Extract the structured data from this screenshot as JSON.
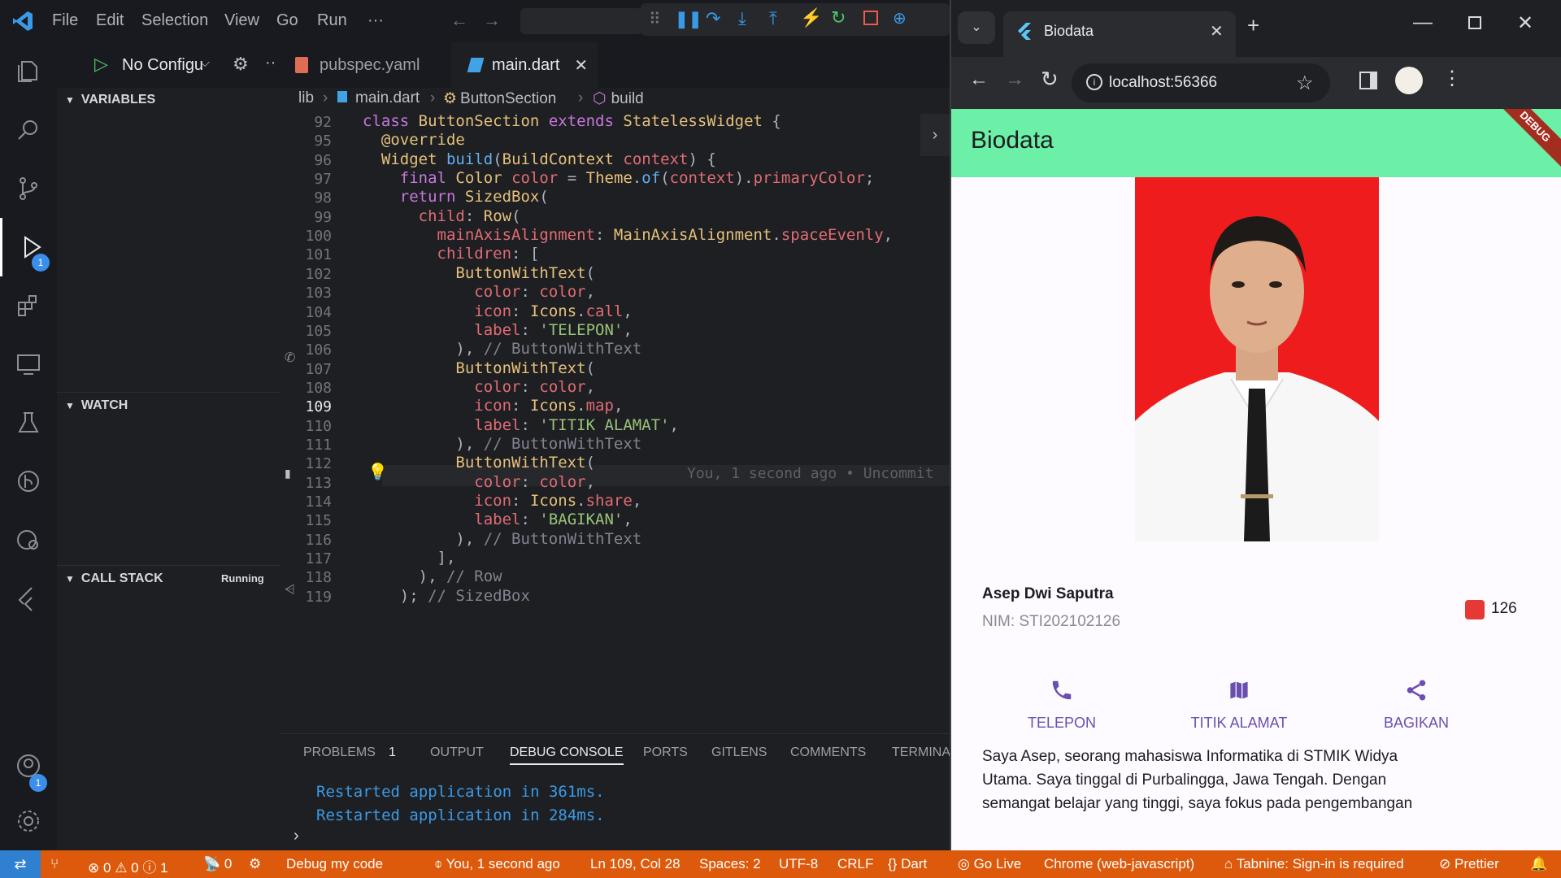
{
  "vscode": {
    "menu": [
      "File",
      "Edit",
      "Selection",
      "View",
      "Go",
      "Run",
      "···"
    ],
    "run_config": "No Configu",
    "tabs": [
      {
        "label": "pubspec.yaml"
      },
      {
        "label": "main.dart"
      }
    ],
    "breadcrumb": [
      "lib",
      "main.dart",
      "ButtonSection",
      "build"
    ],
    "sidebar": {
      "variables": "VARIABLES",
      "watch": "WATCH",
      "call_stack": "CALL STACK",
      "call_stack_status": "Running"
    },
    "activity_badges": {
      "debug": "1",
      "accounts": "1"
    },
    "code_lines": [
      {
        "n": "92",
        "t": "class ButtonSection extends StatelessWidget {"
      },
      {
        "n": "95",
        "t": "  @override"
      },
      {
        "n": "96",
        "t": "  Widget build(BuildContext context) {"
      },
      {
        "n": "97",
        "t": "    final Color color = Theme.of(context).primaryColor;"
      },
      {
        "n": "98",
        "t": "    return SizedBox("
      },
      {
        "n": "99",
        "t": "      child: Row("
      },
      {
        "n": "100",
        "t": "        mainAxisAlignment: MainAxisAlignment.spaceEvenly,"
      },
      {
        "n": "101",
        "t": "        children: ["
      },
      {
        "n": "102",
        "t": "          ButtonWithText("
      },
      {
        "n": "103",
        "t": "            color: color,"
      },
      {
        "n": "104",
        "t": "            icon: Icons.call,"
      },
      {
        "n": "105",
        "t": "            label: 'TELEPON',"
      },
      {
        "n": "106",
        "t": "          ), // ButtonWithText"
      },
      {
        "n": "107",
        "t": "          ButtonWithText("
      },
      {
        "n": "108",
        "t": "            color: color,"
      },
      {
        "n": "109",
        "t": "            icon: Icons.map,"
      },
      {
        "n": "110",
        "t": "            label: 'TITIK ALAMAT',"
      },
      {
        "n": "111",
        "t": "          ), // ButtonWithText"
      },
      {
        "n": "112",
        "t": "          ButtonWithText("
      },
      {
        "n": "113",
        "t": "            color: color,"
      },
      {
        "n": "114",
        "t": "            icon: Icons.share,"
      },
      {
        "n": "115",
        "t": "            label: 'BAGIKAN',"
      },
      {
        "n": "116",
        "t": "          ), // ButtonWithText"
      },
      {
        "n": "117",
        "t": "        ],"
      },
      {
        "n": "118",
        "t": "      ), // Row"
      },
      {
        "n": "119",
        "t": "    ); // SizedBox"
      }
    ],
    "blame": "You, 1 second ago • Uncommit",
    "panel_tabs": [
      "PROBLEMS",
      "1",
      "OUTPUT",
      "DEBUG CONSOLE",
      "PORTS",
      "GITLENS",
      "COMMENTS",
      "TERMINA"
    ],
    "console": [
      "Restarted application in 361ms.",
      "Restarted application in 284ms."
    ],
    "status": {
      "errors": "0",
      "warnings": "0",
      "info": "1",
      "ports": "0",
      "debug": "Debug my code",
      "blame": "You, 1 second ago",
      "position": "Ln 109, Col 28",
      "spaces": "Spaces: 2",
      "encoding": "UTF-8",
      "eol": "CRLF",
      "lang": "Dart",
      "golive": "Go Live",
      "device": "Chrome (web-javascript)",
      "tabnine": "Tabnine: Sign-in is required",
      "prettier": "Prettier"
    }
  },
  "browser": {
    "tab_title": "Biodata",
    "url": "localhost:56366",
    "app_title": "Biodata",
    "debug_banner": "DEBUG",
    "name": "Asep Dwi Saputra",
    "nim": "NIM: STI202102126",
    "count": "126",
    "actions": [
      {
        "label": "TELEPON",
        "icon": "phone-icon"
      },
      {
        "label": "TITIK ALAMAT",
        "icon": "map-icon"
      },
      {
        "label": "BAGIKAN",
        "icon": "share-icon"
      }
    ],
    "bio": [
      "Saya Asep, seorang mahasiswa Informatika di STMIK Widya",
      "Utama. Saya tinggal di Purbalingga, Jawa Tengah. Dengan",
      "semangat belajar yang tinggi, saya fokus pada pengembangan"
    ]
  },
  "colors": {
    "accent": "#6a4fb0",
    "appbar": "#6cf0a8",
    "statusbar": "#dd5a0c",
    "photo_bg": "#ee1c1c"
  }
}
